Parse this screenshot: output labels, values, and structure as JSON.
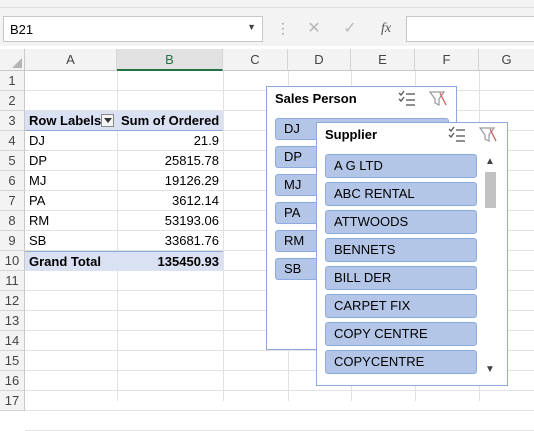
{
  "formula_bar": {
    "name_box": "B21",
    "cancel_icon": "✕",
    "enter_icon": "✓",
    "function_icon": "fx",
    "dots": "⋮",
    "formula": ""
  },
  "columns": [
    "A",
    "B",
    "C",
    "D",
    "E",
    "F",
    "G"
  ],
  "rows": [
    "1",
    "2",
    "3",
    "4",
    "5",
    "6",
    "7",
    "8",
    "9",
    "10",
    "11",
    "12",
    "13",
    "14",
    "15",
    "16",
    "17"
  ],
  "pivot": {
    "header_row_labels": "Row Labels",
    "header_value": "Sum of Ordered",
    "rows": [
      {
        "label": "DJ",
        "value": "21.9"
      },
      {
        "label": "DP",
        "value": "25815.78"
      },
      {
        "label": "MJ",
        "value": "19126.29"
      },
      {
        "label": "PA",
        "value": "3612.14"
      },
      {
        "label": "RM",
        "value": "53193.06"
      },
      {
        "label": "SB",
        "value": "33681.76"
      }
    ],
    "total_label": "Grand Total",
    "total_value": "135450.93"
  },
  "slicer_sales": {
    "title": "Sales Person",
    "items": [
      "DJ",
      "DP",
      "MJ",
      "PA",
      "RM",
      "SB"
    ]
  },
  "slicer_supplier": {
    "title": "Supplier",
    "items": [
      "A G LTD",
      "ABC RENTAL",
      "ATTWOODS",
      "BENNETS",
      "BILL DER",
      "CARPET FIX",
      "COPY CENTRE",
      "COPYCENTRE"
    ]
  },
  "colors": {
    "accent_green": "#217346",
    "pivot_header": "#d9e1f2",
    "slicer_item": "#b4c6e7",
    "slicer_border": "#8ea9db"
  }
}
